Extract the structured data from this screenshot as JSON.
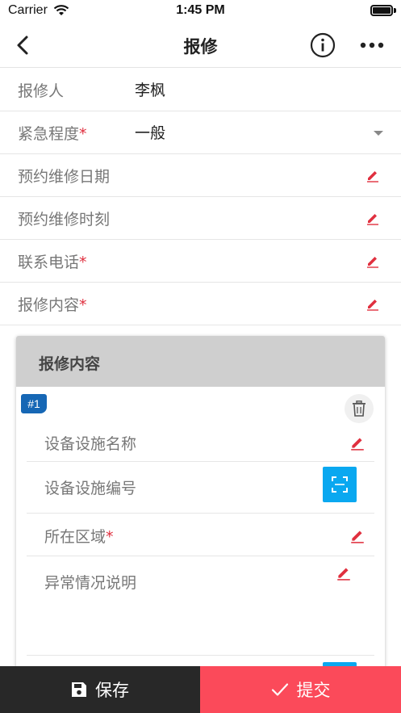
{
  "status_bar": {
    "carrier": "Carrier",
    "time": "1:45 PM"
  },
  "nav": {
    "title": "报修",
    "back_icon": "chevron-left-icon",
    "info_icon": "info-circle-icon",
    "more_icon": "more-horizontal-icon"
  },
  "form": {
    "reporter": {
      "label": "报修人",
      "value": "李枫"
    },
    "urgency": {
      "label": "紧急程度",
      "required_mark": "*",
      "value": "一般"
    },
    "date": {
      "label": "预约维修日期"
    },
    "time": {
      "label": "预约维修时刻"
    },
    "phone": {
      "label": "联系电话",
      "required_mark": "*"
    },
    "content": {
      "label": "报修内容",
      "required_mark": "*"
    }
  },
  "card": {
    "title": "报修内容",
    "badge": "#1",
    "items": [
      {
        "label": "设备设施名称",
        "required_mark": ""
      },
      {
        "label": "设备设施编号",
        "required_mark": ""
      },
      {
        "label": "所在区域",
        "required_mark": "*"
      },
      {
        "label": "异常情况说明",
        "required_mark": ""
      }
    ]
  },
  "bottom": {
    "save_label": "保存",
    "submit_label": "提交"
  },
  "colors": {
    "accent_red": "#fb4a5a",
    "required_red": "#e0303f",
    "scan_blue": "#0aa8f0",
    "badge_blue": "#1667b5",
    "dark": "#282828"
  }
}
